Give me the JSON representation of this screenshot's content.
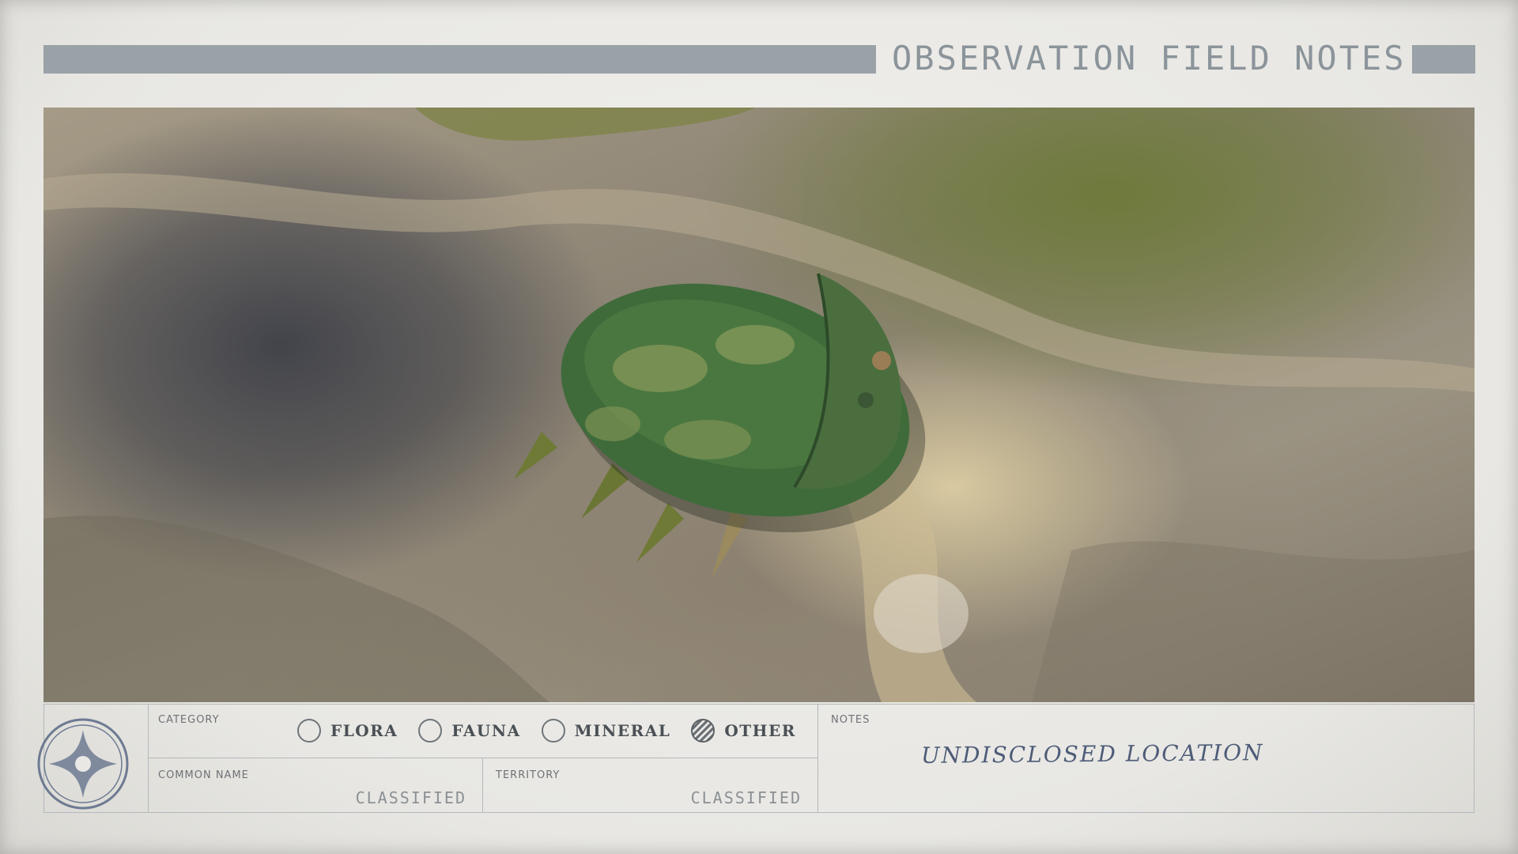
{
  "header": {
    "title": "OBSERVATION FIELD NOTES"
  },
  "category": {
    "label": "CATEGORY",
    "options": [
      {
        "label": "FLORA",
        "selected": false
      },
      {
        "label": "FAUNA",
        "selected": false
      },
      {
        "label": "MINERAL",
        "selected": false
      },
      {
        "label": "OTHER",
        "selected": true
      }
    ]
  },
  "common_name": {
    "label": "COMMON NAME",
    "value": "CLASSIFIED"
  },
  "territory": {
    "label": "TERRITORY",
    "value": "CLASSIFIED"
  },
  "notes": {
    "label": "NOTES",
    "text": "UNDISCLOSED LOCATION"
  },
  "icons": {
    "seal": "star-seal-icon",
    "radio_selected": "hatched-radio",
    "radio_empty": "empty-radio"
  },
  "colors": {
    "paper": "#e9e8e4",
    "header_bar": "#9aa2a8",
    "ink_blue": "#4e5c78",
    "creature_green": "#3f6b3a"
  }
}
